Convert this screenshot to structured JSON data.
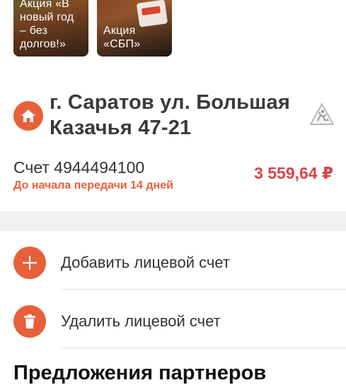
{
  "promos": [
    {
      "text": "Акция «В\nновый год\n– без\nдолгов!»"
    },
    {
      "text": "Акция\n«СБП»"
    }
  ],
  "account": {
    "address": "г. Саратов ул. Большая Казачья 47-21",
    "number_label": "Счет 4944494100",
    "deadline": "До начала передачи 14 дней",
    "balance": "3 559,64 ₽"
  },
  "actions": {
    "add_label": "Добавить лицевой счет",
    "delete_label": "Удалить лицевой счет"
  },
  "partners": {
    "title": "Предложения партнеров"
  },
  "colors": {
    "accent": "#e8603a",
    "balance": "#d64545",
    "separator_bg": "#f1f1f3"
  }
}
